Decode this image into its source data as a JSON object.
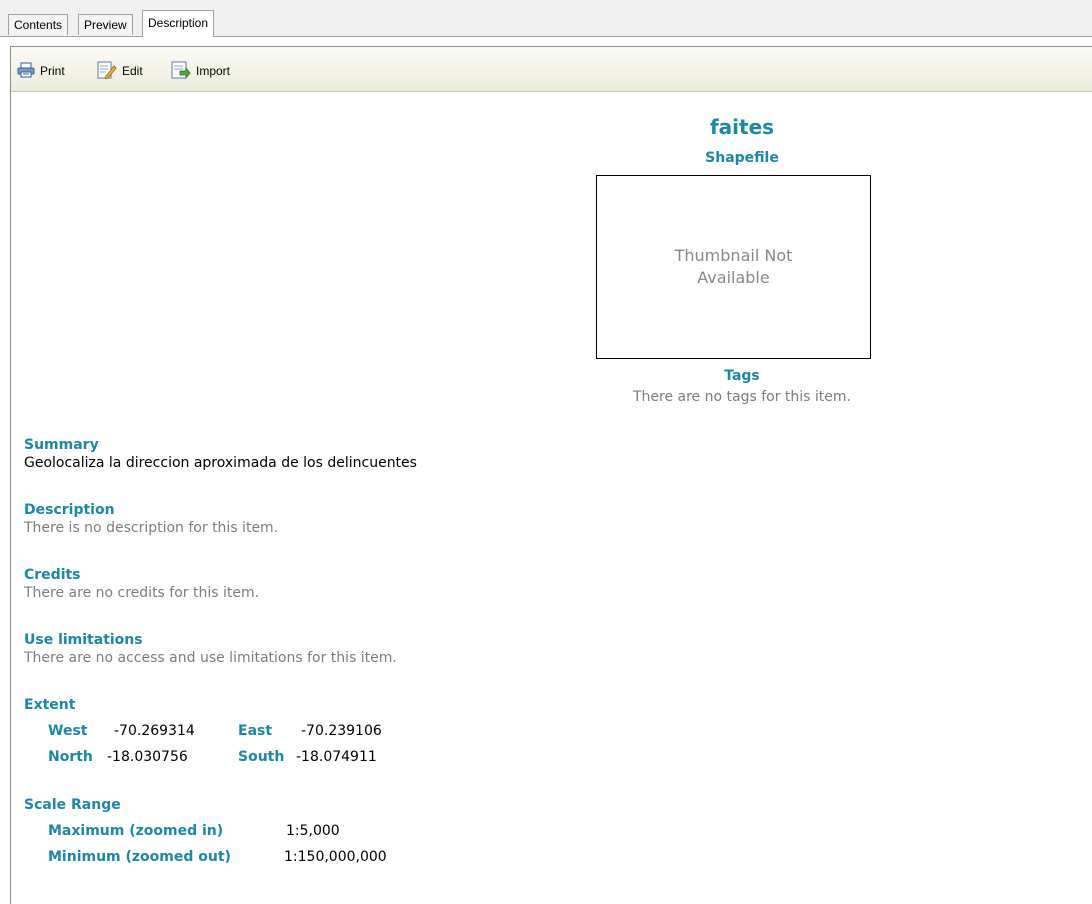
{
  "tabs": [
    {
      "label": "Contents",
      "active": false
    },
    {
      "label": "Preview",
      "active": false
    },
    {
      "label": "Description",
      "active": true
    }
  ],
  "toolbar": {
    "print_label": "Print",
    "edit_label": "Edit",
    "import_label": "Import"
  },
  "item": {
    "title": "faites",
    "type": "Shapefile",
    "thumbnail_text": "Thumbnail Not Available",
    "tags_heading": "Tags",
    "tags_text": "There are no tags for this item."
  },
  "summary": {
    "heading": "Summary",
    "text": "Geolocaliza la direccion aproximada de los delincuentes"
  },
  "description": {
    "heading": "Description",
    "text": "There is no description for this item."
  },
  "credits": {
    "heading": "Credits",
    "text": "There are no credits for this item."
  },
  "use_limitations": {
    "heading": "Use limitations",
    "text": "There are no access and use limitations for this item."
  },
  "extent": {
    "heading": "Extent",
    "west_label": "West",
    "west_value": "-70.269314",
    "east_label": "East",
    "east_value": "-70.239106",
    "north_label": "North",
    "north_value": "-18.030756",
    "south_label": "South",
    "south_value": "-18.074911"
  },
  "scale_range": {
    "heading": "Scale Range",
    "max_label": "Maximum (zoomed in)",
    "max_value": "1:5,000",
    "min_label": "Minimum (zoomed out)",
    "min_value": "1:150,000,000"
  },
  "colors": {
    "accent": "#1a88a8",
    "muted_text": "#7d7d7d"
  }
}
